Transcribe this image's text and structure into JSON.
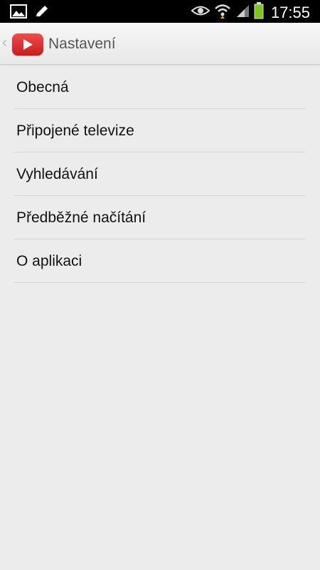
{
  "status_bar": {
    "time": "17:55",
    "icons": [
      "gallery-icon",
      "pencil-icon",
      "eye-icon",
      "wifi-icon",
      "signal-icon",
      "battery-icon"
    ]
  },
  "action_bar": {
    "title": "Nastavení",
    "logo": "youtube-logo-icon"
  },
  "settings_items": [
    {
      "label": "Obecná"
    },
    {
      "label": "Připojené televize"
    },
    {
      "label": "Vyhledávání"
    },
    {
      "label": "Předběžné načítání"
    },
    {
      "label": "O aplikaci"
    }
  ],
  "colors": {
    "background": "#ececec",
    "statusbar": "#000000",
    "youtube_red": "#e02a2a",
    "battery_green": "#7cc41f"
  }
}
